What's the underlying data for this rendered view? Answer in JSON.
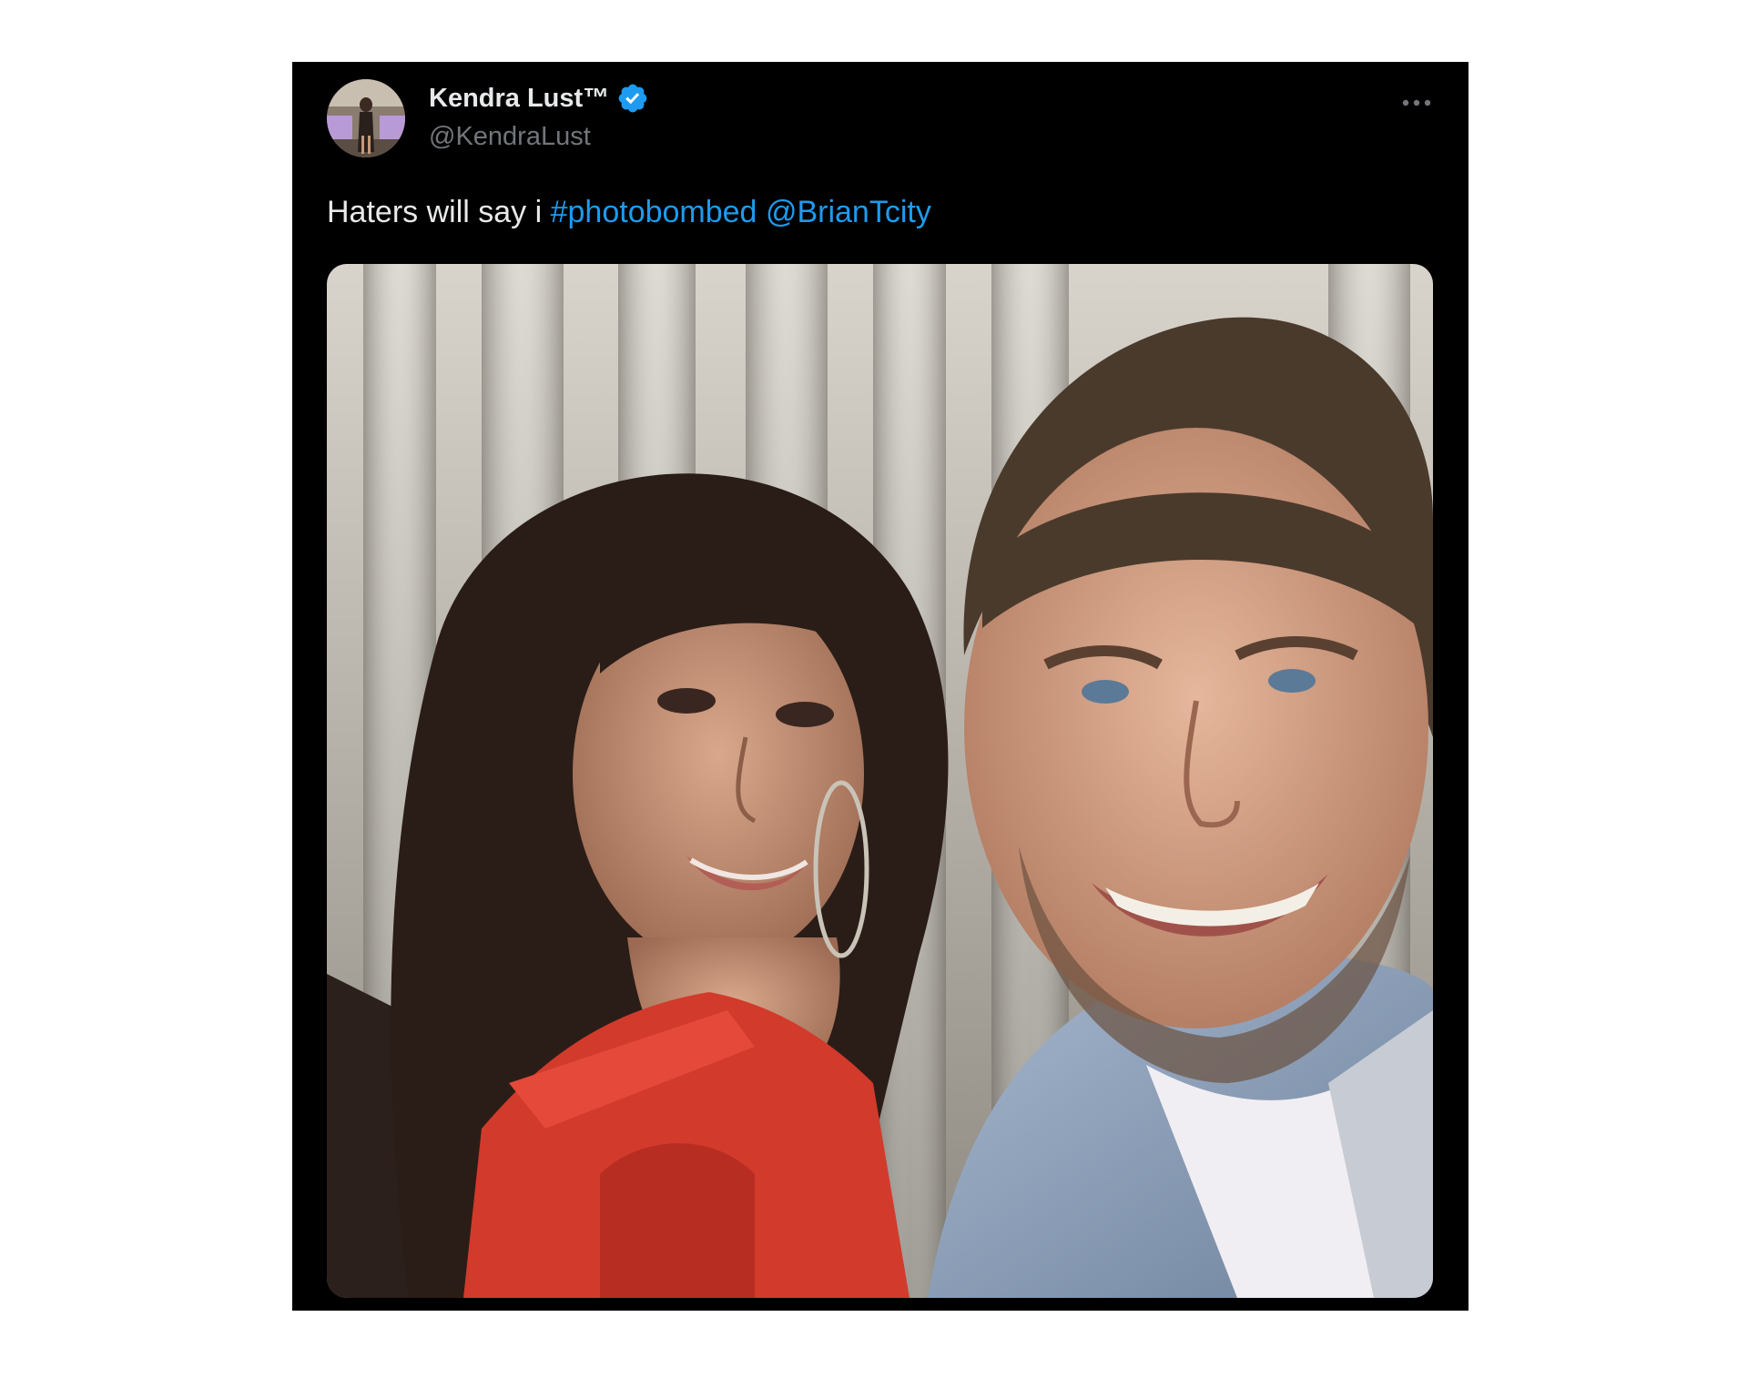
{
  "tweet": {
    "author": {
      "display_name": "Kendra Lust™",
      "handle": "@KendraLust",
      "verified": true,
      "avatar_icon": "profile-photo"
    },
    "text_prefix": "Haters will say i ",
    "hashtag": "#photobombed",
    "mention": "@BrianTcity",
    "menu_icon": "more-horizontal-icon",
    "colors": {
      "card_background": "#000000",
      "text": "#e7e9ea",
      "secondary_text": "#71767b",
      "link": "#1d9bf0",
      "verified_badge": "#1d9bf0"
    },
    "media": {
      "type": "photo",
      "subject": "selfie"
    }
  }
}
